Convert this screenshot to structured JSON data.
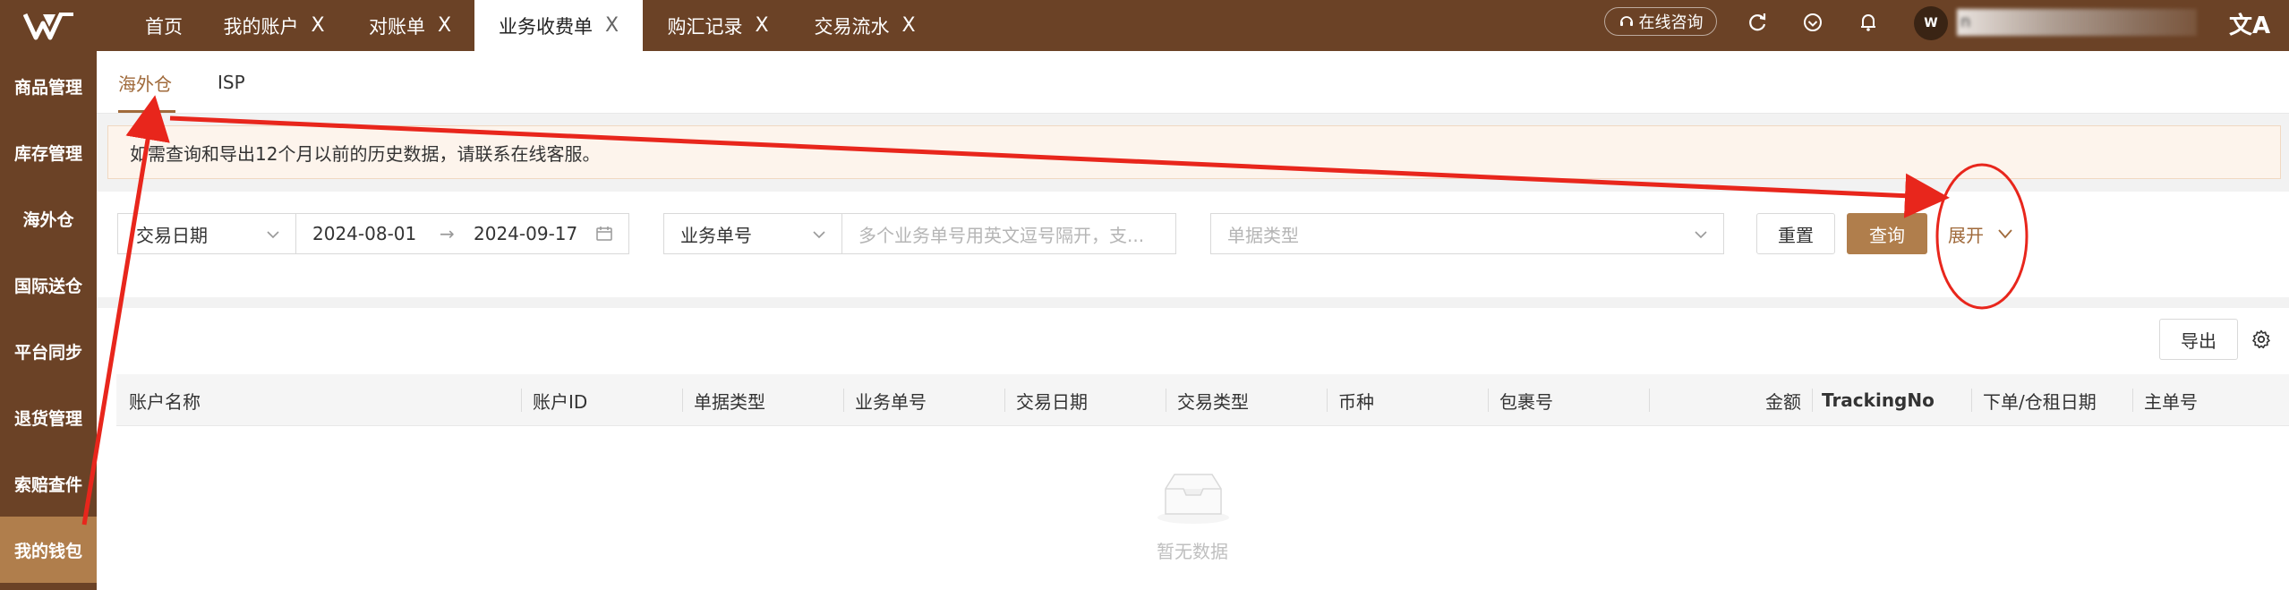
{
  "topbar": {
    "tabs": [
      {
        "label": "首页",
        "closable": false,
        "active": false
      },
      {
        "label": "我的账户",
        "closable": true,
        "active": false
      },
      {
        "label": "对账单",
        "closable": true,
        "active": false
      },
      {
        "label": "业务收费单",
        "closable": true,
        "active": true
      },
      {
        "label": "购汇记录",
        "closable": true,
        "active": false
      },
      {
        "label": "交易流水",
        "closable": true,
        "active": false
      }
    ],
    "close_glyph": "X",
    "consult_label": "在线咨询",
    "avatar_text": "W",
    "username": "n",
    "lang_glyph": "文A"
  },
  "sidebar": {
    "items": [
      {
        "label": "商品管理",
        "active": false
      },
      {
        "label": "库存管理",
        "active": false
      },
      {
        "label": "海外仓",
        "active": false
      },
      {
        "label": "国际送仓",
        "active": false
      },
      {
        "label": "平台同步",
        "active": false
      },
      {
        "label": "退货管理",
        "active": false
      },
      {
        "label": "索赔查件",
        "active": false
      },
      {
        "label": "我的钱包",
        "active": true
      }
    ]
  },
  "subtabs": [
    {
      "label": "海外仓",
      "active": true
    },
    {
      "label": "ISP",
      "active": false
    }
  ],
  "alert": {
    "text": "如需查询和导出12个月以前的历史数据，请联系在线客服。"
  },
  "filters": {
    "date_type": "交易日期",
    "date_start": "2024-08-01",
    "date_end": "2024-09-17",
    "range_arrow": "→",
    "order_field": "业务单号",
    "order_placeholder": "多个业务单号用英文逗号隔开，支...",
    "doc_type_placeholder": "单据类型",
    "reset_label": "重置",
    "query_label": "查询",
    "expand_label": "展开"
  },
  "table": {
    "export_label": "导出",
    "columns": [
      "账户名称",
      "账户ID",
      "单据类型",
      "业务单号",
      "交易日期",
      "交易类型",
      "币种",
      "包裹号",
      "金额",
      "TrackingNo",
      "下单/仓租日期",
      "主单号"
    ],
    "rows": [],
    "empty_text": "暂无数据"
  },
  "colors": {
    "brand": "#6b4226",
    "accent": "#b07e4c",
    "annotation": "#e8261c"
  }
}
